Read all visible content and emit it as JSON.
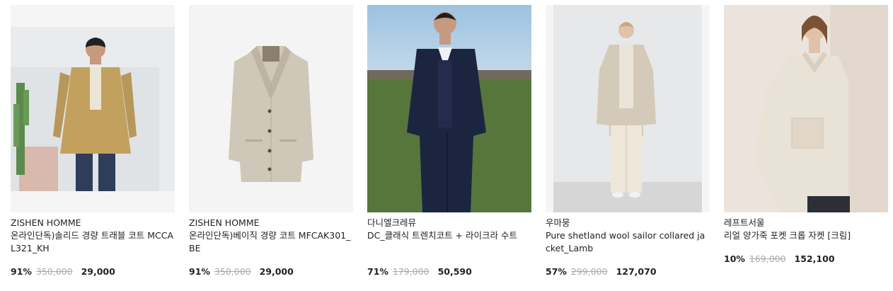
{
  "products": [
    {
      "brand": "ZISHEN HOMME",
      "name": "온라인단독)솔리드 경량 트래블 코트 MCCAL321_KH",
      "discount": "91%",
      "original_price": "350,000",
      "sale_price": "29,000",
      "image_alt": "man in khaki travel coat"
    },
    {
      "brand": "ZISHEN HOMME",
      "name": "온라인단독)베이직 경량 코트 MFCAK301_BE",
      "discount": "91%",
      "original_price": "350,000",
      "sale_price": "29,000",
      "image_alt": "beige lightweight coat"
    },
    {
      "brand": "다니엘크레뮤",
      "name": "DC_클래식 트렌치코트 + 라이크라 수트",
      "discount": "71%",
      "original_price": "179,000",
      "sale_price": "50,590",
      "image_alt": "man in navy three-piece suit"
    },
    {
      "brand": "우마뭉",
      "name": "Pure shetland wool sailor collared jacket_Lamb",
      "discount": "57%",
      "original_price": "299,000",
      "sale_price": "127,070",
      "image_alt": "woman in lamb sailor collar jacket"
    },
    {
      "brand": "레프트서울",
      "name": "리얼 양가죽 포켓 크롭 자켓 [크림]",
      "discount": "10%",
      "original_price": "169,000",
      "sale_price": "152,100",
      "image_alt": "woman in cream leather cropped jacket"
    }
  ],
  "colors": {
    "text": "#222222",
    "strike": "#aaaaaa",
    "thumb_bg": "#f5f5f5"
  }
}
